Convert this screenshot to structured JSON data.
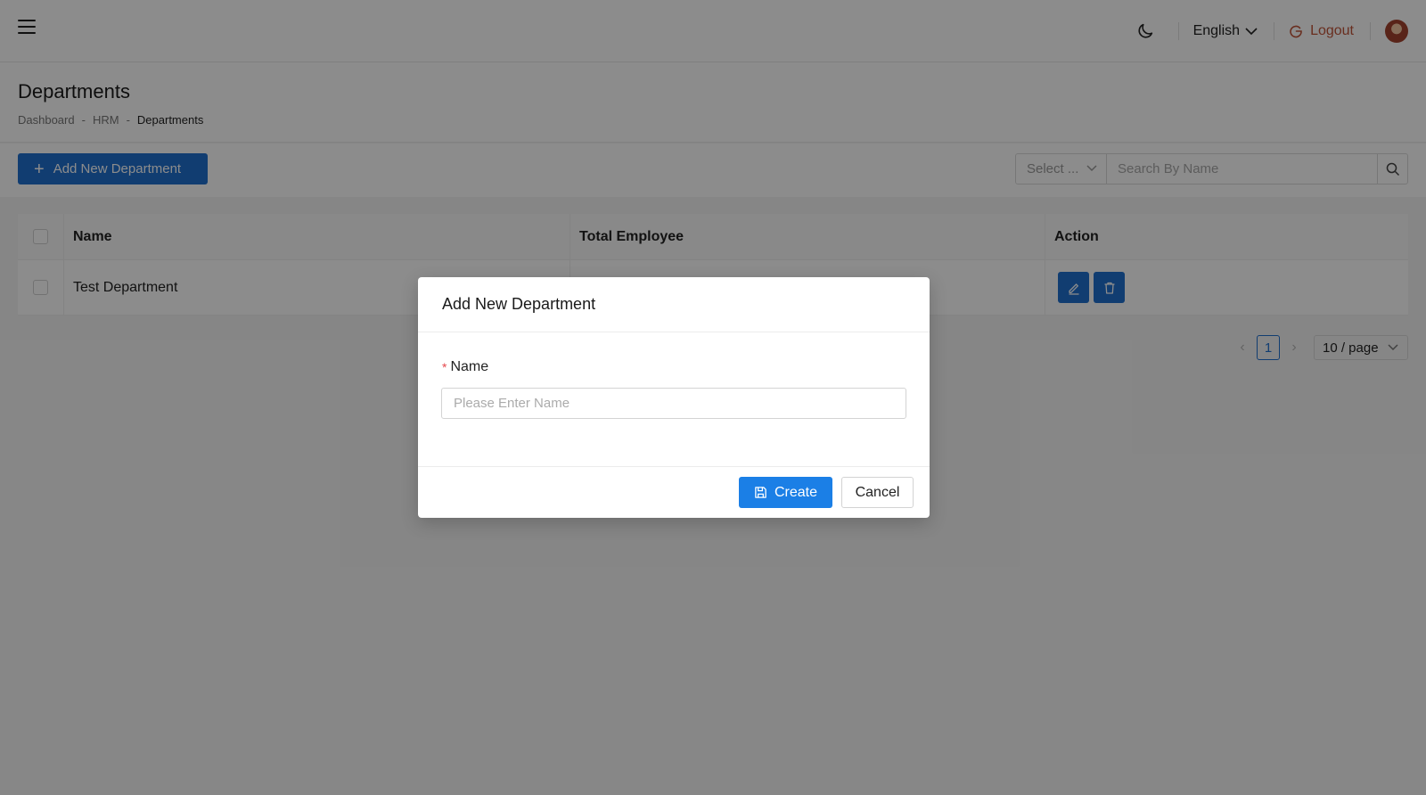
{
  "header": {
    "language": "English",
    "logout_label": "Logout"
  },
  "page": {
    "title": "Departments",
    "breadcrumb": [
      "Dashboard",
      "HRM",
      "Departments"
    ],
    "breadcrumb_separator": "-"
  },
  "toolbar": {
    "add_label": "Add New Department",
    "filter_placeholder": "Select ...",
    "search_placeholder": "Search By Name"
  },
  "table": {
    "columns": [
      "Name",
      "Total Employee",
      "Action"
    ],
    "rows": [
      {
        "name": "Test Department",
        "total_employee": ""
      }
    ]
  },
  "pagination": {
    "current_page": "1",
    "page_size": "10 / page"
  },
  "modal": {
    "title": "Add New Department",
    "field_label": "Name",
    "required_mark": "*",
    "field_placeholder": "Please Enter Name",
    "field_value": "",
    "create_label": "Create",
    "cancel_label": "Cancel"
  },
  "colors": {
    "primary": "#1f6fce",
    "create_button": "#1b7fe6",
    "logout": "#c0553a",
    "required": "#e5484d"
  },
  "icons": [
    "menu-icon",
    "moon-icon",
    "chevron-down-icon",
    "logout-icon",
    "avatar",
    "plus-icon",
    "search-icon",
    "edit-icon",
    "delete-icon",
    "save-icon",
    "chevron-left-icon",
    "chevron-right-icon"
  ]
}
